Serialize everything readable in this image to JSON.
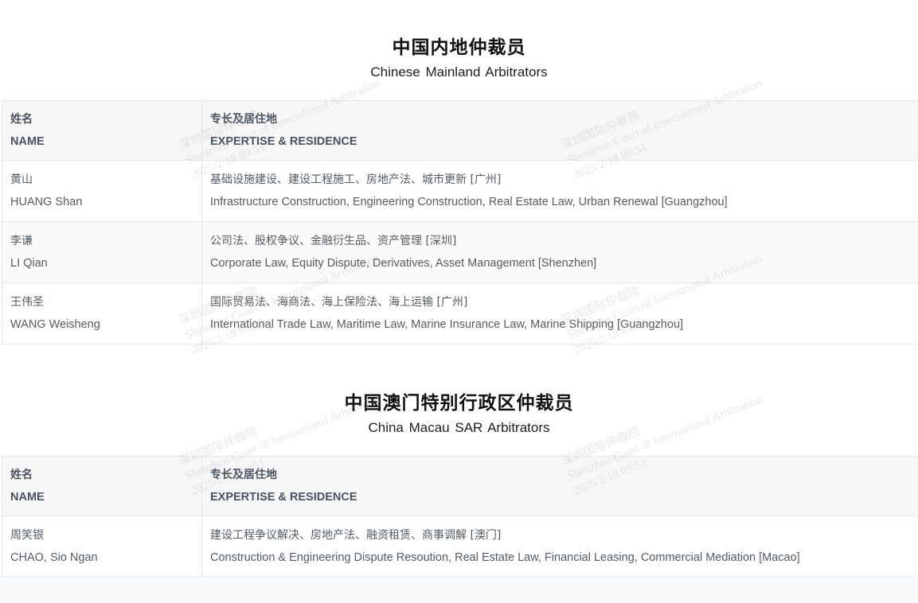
{
  "sections": [
    {
      "title_cn": "中国内地仲裁员",
      "title_en": "Chinese Mainland Arbitrators",
      "header": {
        "name_cn": "姓名",
        "name_en": "NAME",
        "expertise_cn": "专长及居住地",
        "expertise_en": "EXPERTISE & RESIDENCE"
      },
      "rows": [
        {
          "name_cn": "黄山",
          "name_en": "HUANG Shan",
          "expertise_cn": "基础设施建设、建设工程施工、房地产法、城市更新 [广州]",
          "expertise_en": "Infrastructure Construction, Engineering Construction, Real Estate Law, Urban Renewal [Guangzhou]"
        },
        {
          "name_cn": "李谦",
          "name_en": "LI Qian",
          "expertise_cn": "公司法、股权争议、金融衍生品、资产管理 [深圳]",
          "expertise_en": "Corporate Law, Equity Dispute, Derivatives, Asset Management [Shenzhen]"
        },
        {
          "name_cn": "王伟圣",
          "name_en": "WANG Weisheng",
          "expertise_cn": "国际贸易法、海商法、海上保险法、海上运输 [广州]",
          "expertise_en": "International Trade Law, Maritime Law, Marine Insurance Law, Marine Shipping [Guangzhou]"
        }
      ]
    },
    {
      "title_cn": "中国澳门特别行政区仲裁员",
      "title_en": "China Macau SAR Arbitrators",
      "header": {
        "name_cn": "姓名",
        "name_en": "NAME",
        "expertise_cn": "专长及居住地",
        "expertise_en": "EXPERTISE & RESIDENCE"
      },
      "rows": [
        {
          "name_cn": "周笑银",
          "name_en": "CHAO, Sio Ngan",
          "expertise_cn": "建设工程争议解决、房地产法、融资租赁、商事调解 [澳门]",
          "expertise_en": "Construction & Engineering Dispute Resoution, Real Estate Law, Financial Leasing, Commercial Mediation [Macao]"
        }
      ]
    }
  ],
  "watermark": {
    "org_cn": "深圳国际仲裁院",
    "org_en": "Shenzhen Court of International Arbitration",
    "timestamp": "2025/2/18 09:51"
  }
}
